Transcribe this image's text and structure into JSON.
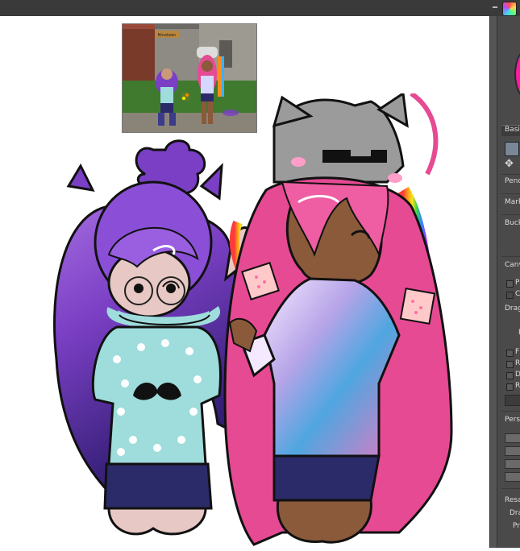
{
  "panel": {
    "tab_label": "Basic",
    "preset_labels": [
      "Pencil",
      "Mark",
      "Bucket"
    ],
    "canvas_label": "Canv",
    "checkbox_labels": [
      "P",
      "C"
    ],
    "drag_label": "Drag",
    "field_label": "F",
    "option_labels": [
      "F",
      "R",
      "D",
      "R"
    ],
    "perspective_label": "Persp",
    "resample_label": "Resa",
    "draw_label": "Dra",
    "preview_label": "Pr"
  },
  "reference": {
    "sign_text": "Nineteen"
  },
  "colors": {
    "panel_bg": "#4a4a4a",
    "topbar_bg": "#3a3a3a",
    "brush_color": "#ff1aa3",
    "purple_hair": "#7a3fc4",
    "pink_hair": "#e64a93",
    "mint_shirt": "#9fdcdc"
  }
}
